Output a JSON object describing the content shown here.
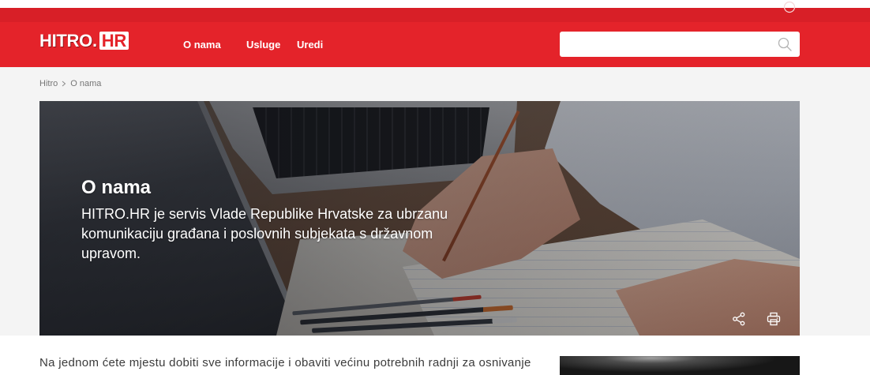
{
  "colors": {
    "brand_red": "#e4232a",
    "top_strip_red": "#d81f27",
    "page_background": "#f4f4f4",
    "body_text": "#3b3b3b"
  },
  "top_bar": {
    "icon": "circle-icon"
  },
  "header": {
    "logo": {
      "text_main": "HITRO.",
      "text_box": "HR"
    },
    "nav": [
      {
        "label": "O nama"
      },
      {
        "label": "Usluge"
      },
      {
        "label": "Uredi"
      }
    ],
    "search": {
      "value": "",
      "icon": "search-icon"
    }
  },
  "breadcrumb": {
    "items": [
      {
        "label": "Hitro"
      },
      {
        "label": "O nama"
      }
    ],
    "separator_icon": "chevron-right-icon"
  },
  "hero": {
    "title": "O nama",
    "text": "HITRO.HR je servis Vlade Republike Hrvatske za ubrzanu komunikaciju građana i poslovnih subjekata s državnom upravom.",
    "actions": [
      {
        "icon": "share-icon"
      },
      {
        "icon": "print-icon"
      }
    ]
  },
  "content": {
    "intro": "Na jednom ćete mjestu dobiti sve informacije i obaviti većinu potrebnih radnji za osnivanje"
  }
}
